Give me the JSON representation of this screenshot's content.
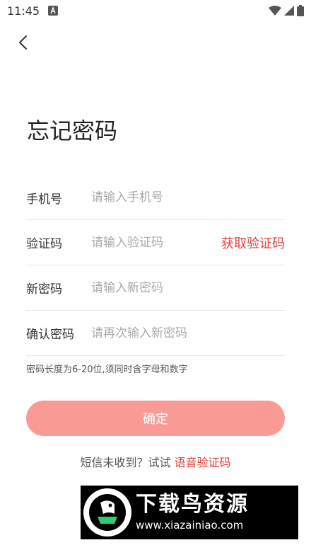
{
  "status_bar": {
    "time": "11:45",
    "notification_icon": "a-box-icon"
  },
  "title": "忘记密码",
  "fields": [
    {
      "label": "手机号",
      "placeholder": "请输入手机号"
    },
    {
      "label": "验证码",
      "placeholder": "请输入验证码",
      "action": "获取验证码"
    },
    {
      "label": "新密码",
      "placeholder": "请输入新密码"
    },
    {
      "label": "确认密码",
      "placeholder": "请再次输入新密码"
    }
  ],
  "hint": "密码长度为6-20位,须同时含字母和数字",
  "confirm_label": "确定",
  "voice": {
    "prefix": "短信未收到？试试 ",
    "link": "语音验证码"
  },
  "watermark": {
    "title": "下载鸟资源",
    "url": "www.xiazainiao.com"
  },
  "colors": {
    "accent": "#e2413a",
    "button": "#f99a95"
  }
}
